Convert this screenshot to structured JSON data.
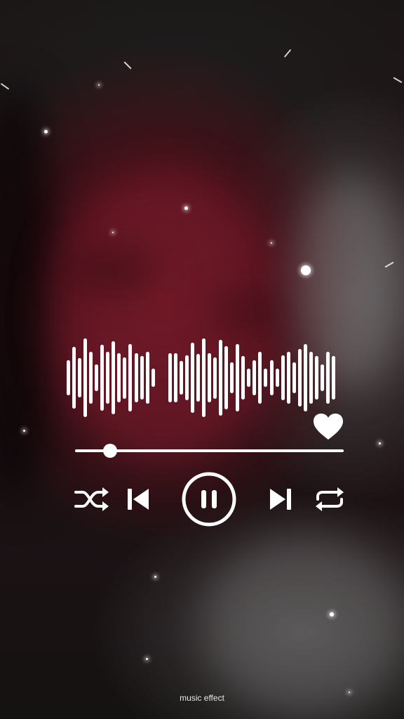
{
  "player": {
    "progress": 0.13,
    "liked": true,
    "waveform_levels": [
      0.42,
      0.75,
      0.48,
      0.95,
      0.62,
      0.32,
      0.8,
      0.62,
      0.88,
      0.6,
      0.5,
      0.82,
      0.6,
      0.52,
      0.62,
      0.22,
      0,
      0,
      0.6,
      0.6,
      0.4,
      0.55,
      0.85,
      0.58,
      0.95,
      0.6,
      0.5,
      0.92,
      0.76,
      0.38,
      0.82,
      0.52,
      0.22,
      0.42,
      0.62,
      0.22,
      0.42,
      0.22,
      0.55,
      0.62,
      0.38,
      0.7,
      0.82,
      0.62,
      0.52,
      0.32,
      0.62,
      0.52
    ],
    "controls": {
      "shuffle_icon": "shuffle-icon",
      "previous_icon": "skip-previous-icon",
      "play_state_icon": "pause-icon",
      "next_icon": "skip-next-icon",
      "repeat_icon": "repeat-icon"
    },
    "accent_color": "#ffffff"
  },
  "caption": "music effect"
}
